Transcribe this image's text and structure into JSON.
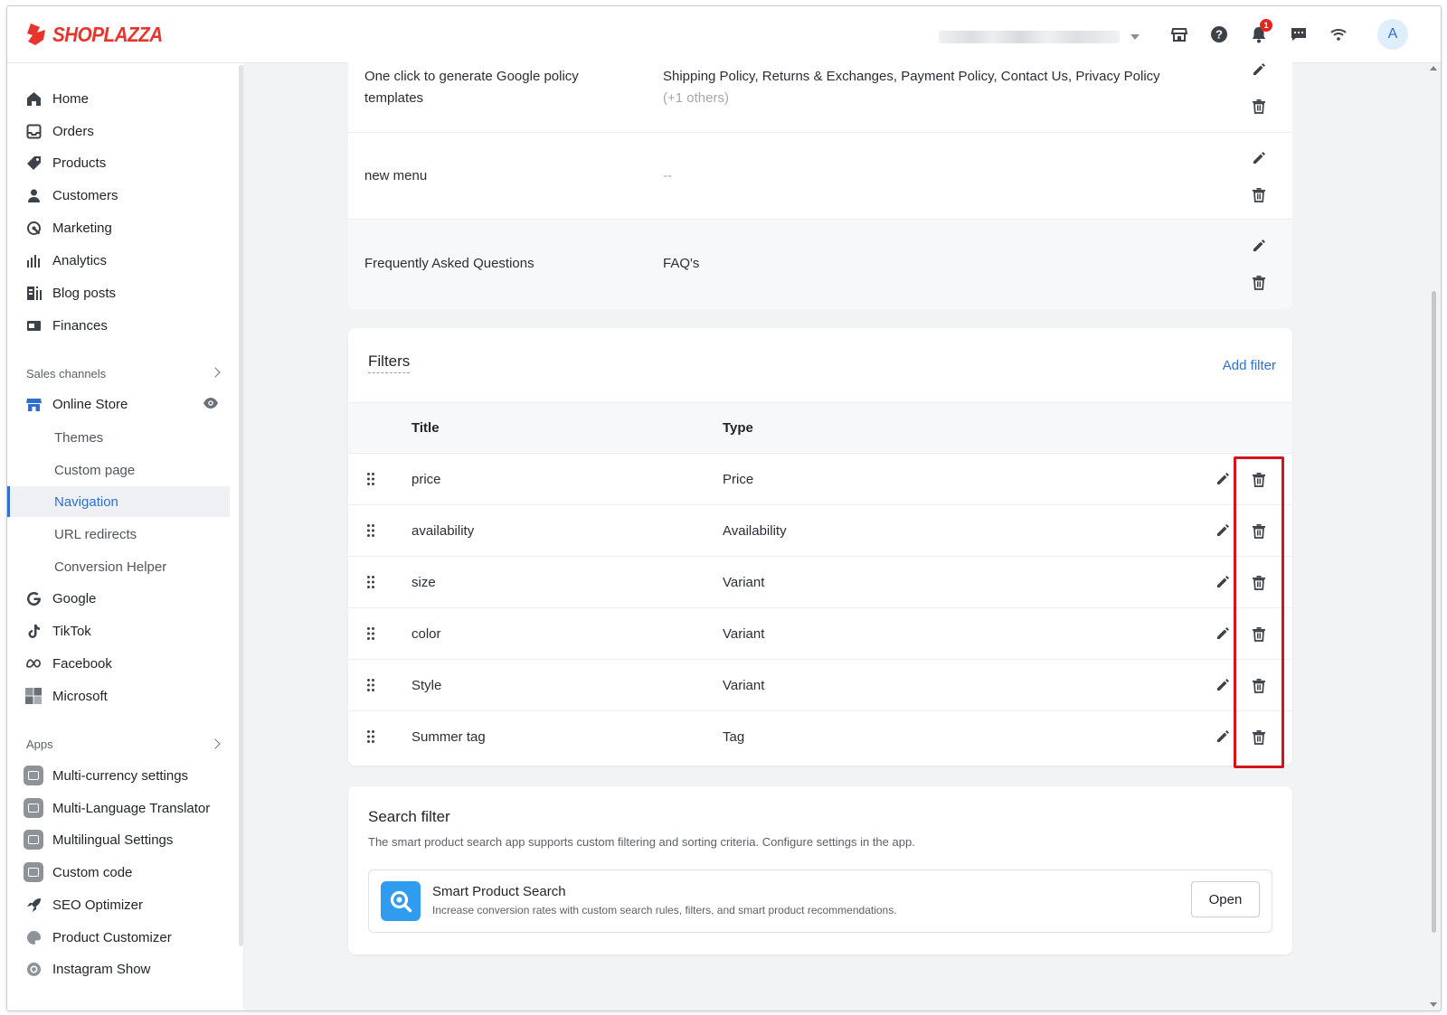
{
  "brand": {
    "name": "SHOPLAZZA",
    "color": "#e8352c"
  },
  "accent_color": "#2f6fd1",
  "topbar": {
    "notifications_count": "1",
    "avatar_initial": "A",
    "icons": [
      "storefront-icon",
      "help-icon",
      "bell-icon",
      "chat-icon",
      "wifi-icon"
    ]
  },
  "sidebar": {
    "main_items": [
      {
        "label": "Home",
        "icon": "home-icon"
      },
      {
        "label": "Orders",
        "icon": "orders-icon"
      },
      {
        "label": "Products",
        "icon": "tag-icon"
      },
      {
        "label": "Customers",
        "icon": "person-icon"
      },
      {
        "label": "Marketing",
        "icon": "marketing-icon"
      },
      {
        "label": "Analytics",
        "icon": "bar-chart-icon"
      },
      {
        "label": "Blog posts",
        "icon": "blog-icon"
      },
      {
        "label": "Finances",
        "icon": "finance-icon"
      }
    ],
    "sales_channels_label": "Sales channels",
    "online_store": "Online Store",
    "online_store_sub": [
      "Themes",
      "Custom page",
      "Navigation",
      "URL redirects",
      "Conversion Helper"
    ],
    "active_sub": "Navigation",
    "channels": [
      {
        "label": "Google",
        "icon": "google-icon"
      },
      {
        "label": "TikTok",
        "icon": "tiktok-icon"
      },
      {
        "label": "Facebook",
        "icon": "meta-icon"
      },
      {
        "label": "Microsoft",
        "icon": "microsoft-icon"
      }
    ],
    "apps_label": "Apps",
    "apps": [
      "Multi-currency settings",
      "Multi-Language Translator",
      "Multilingual Settings",
      "Custom code",
      "SEO Optimizer",
      "Product Customizer",
      "Instagram Show"
    ]
  },
  "menus": [
    {
      "title_line1": "One click to generate Google policy",
      "title_line2": "templates",
      "items": "Shipping Policy, Returns & Exchanges, Payment Policy, Contact Us, Privacy Policy",
      "extra": "(+1 others)"
    },
    {
      "title": "new menu",
      "items": "--"
    },
    {
      "title": "Frequently Asked Questions",
      "items": "FAQ's"
    }
  ],
  "filters": {
    "title": "Filters",
    "add_label": "Add filter",
    "columns": {
      "title": "Title",
      "type": "Type"
    },
    "rows": [
      {
        "title": "price",
        "type": "Price"
      },
      {
        "title": "availability",
        "type": "Availability"
      },
      {
        "title": "size",
        "type": "Variant"
      },
      {
        "title": "color",
        "type": "Variant"
      },
      {
        "title": "Style",
        "type": "Variant"
      },
      {
        "title": "Summer tag",
        "type": "Tag"
      }
    ]
  },
  "search_filter": {
    "title": "Search filter",
    "description": "The smart product search app supports custom filtering and sorting criteria. Configure settings in the app.",
    "app_name": "Smart Product Search",
    "app_description": "Increase conversion rates with custom search rules, filters, and smart product recommendations.",
    "open_label": "Open"
  }
}
